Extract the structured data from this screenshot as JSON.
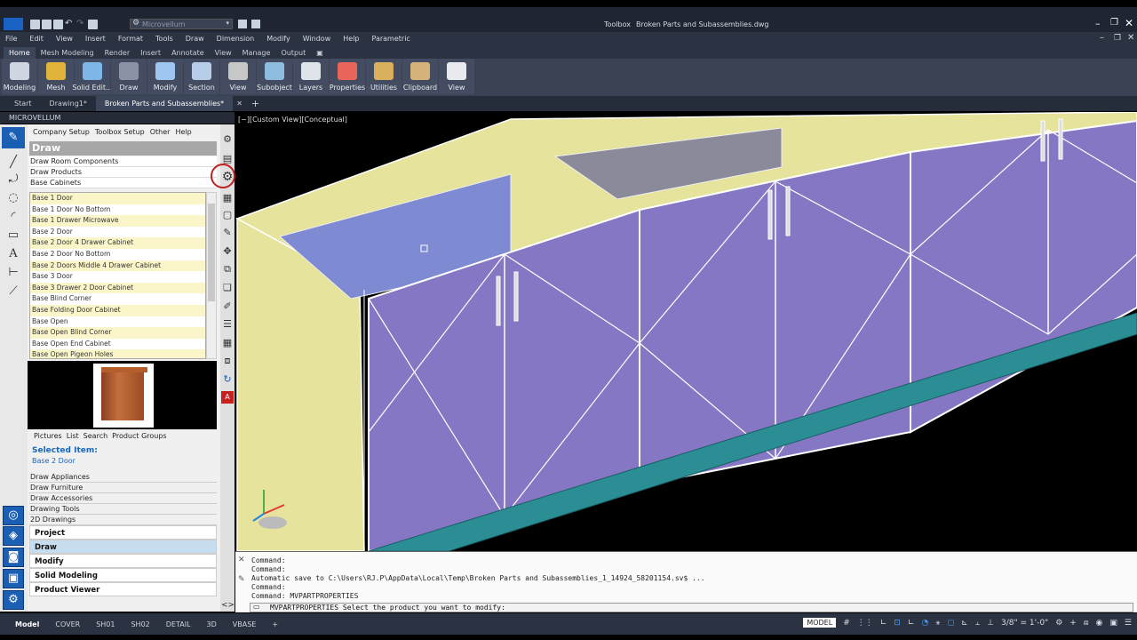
{
  "titlebar": {
    "workspace": "Microvellum",
    "app": "Toolbox",
    "file": "Broken Parts and Subassemblies.dwg"
  },
  "menu": [
    "File",
    "Edit",
    "View",
    "Insert",
    "Format",
    "Tools",
    "Draw",
    "Dimension",
    "Modify",
    "Window",
    "Help",
    "Parametric"
  ],
  "ribbon_tabs": [
    "Home",
    "Mesh Modeling",
    "Render",
    "Insert",
    "Annotate",
    "View",
    "Manage",
    "Output"
  ],
  "ribbon_buttons": [
    {
      "label": "Modeling",
      "color": "#cfd6e2"
    },
    {
      "label": "Mesh",
      "color": "#e0b43a"
    },
    {
      "label": "Solid Edit...",
      "color": "#7fb6e8"
    },
    {
      "label": "Draw",
      "color": "#8a93a5"
    },
    {
      "label": "Modify",
      "color": "#9ec6f0"
    },
    {
      "label": "Section",
      "color": "#b8cde8"
    },
    {
      "label": "View",
      "color": "#c7c7c7"
    },
    {
      "label": "Subobject",
      "color": "#8fbde0"
    },
    {
      "label": "Layers",
      "color": "#dfe3ea"
    },
    {
      "label": "Properties",
      "color": "#e9655a"
    },
    {
      "label": "Utilities",
      "color": "#d9b15c"
    },
    {
      "label": "Clipboard",
      "color": "#d4b27a"
    },
    {
      "label": "View",
      "color": "#e8eaef"
    }
  ],
  "doc_tabs": [
    "Start",
    "Drawing1*",
    "Broken Parts and Subassemblies*"
  ],
  "palette": {
    "title": "MICROVELLUM",
    "menu": [
      "Company Setup",
      "Toolbox Setup",
      "Other",
      "Help"
    ],
    "section": "Draw",
    "nav_rows": [
      "Draw Room Components",
      "Draw Products",
      "Base Cabinets"
    ],
    "items": [
      "Base 1 Door",
      "Base 1 Door No Bottom",
      "Base 1 Drawer Microwave",
      "Base 2 Door",
      "Base 2 Door 4 Drawer Cabinet",
      "Base 2 Door No Bottom",
      "Base 2 Doors Middle 4 Drawer Cabinet",
      "Base 3 Door",
      "Base 3 Drawer 2 Door Cabinet",
      "Base Blind Corner",
      "Base Folding Door Cabinet",
      "Base Open",
      "Base Open Blind Corner",
      "Base Open End Cabinet",
      "Base Open Pigeon Holes"
    ],
    "tabs": [
      "Pictures",
      "List",
      "Search",
      "Product Groups"
    ],
    "selected_title": "Selected Item:",
    "selected_value": "Base 2 Door",
    "links": [
      "Draw Appliances",
      "Draw Furniture",
      "Draw Accessories",
      "Drawing Tools",
      "2D Drawings"
    ],
    "accordion": [
      "Project",
      "Draw",
      "Modify",
      "Solid Modeling",
      "Product Viewer"
    ]
  },
  "viewport": {
    "label": "[−][Custom View][Conceptual]"
  },
  "command_lines": [
    "Command:",
    "Command:",
    "Automatic save to C:\\Users\\RJ.P\\AppData\\Local\\Temp\\Broken Parts and Subassemblies_1_14924_58201154.sv$ ...",
    "Command:",
    "Command: MVPARTPROPERTIES"
  ],
  "command_prompt": "MVPARTPROPERTIES Select the product you want to modify:",
  "layout_tabs": [
    "Model",
    "COVER",
    "SH01",
    "SH02",
    "DETAIL",
    "3D",
    "VBASE"
  ],
  "status": {
    "space": "MODEL",
    "scale": "3/8\" = 1'-0\""
  }
}
